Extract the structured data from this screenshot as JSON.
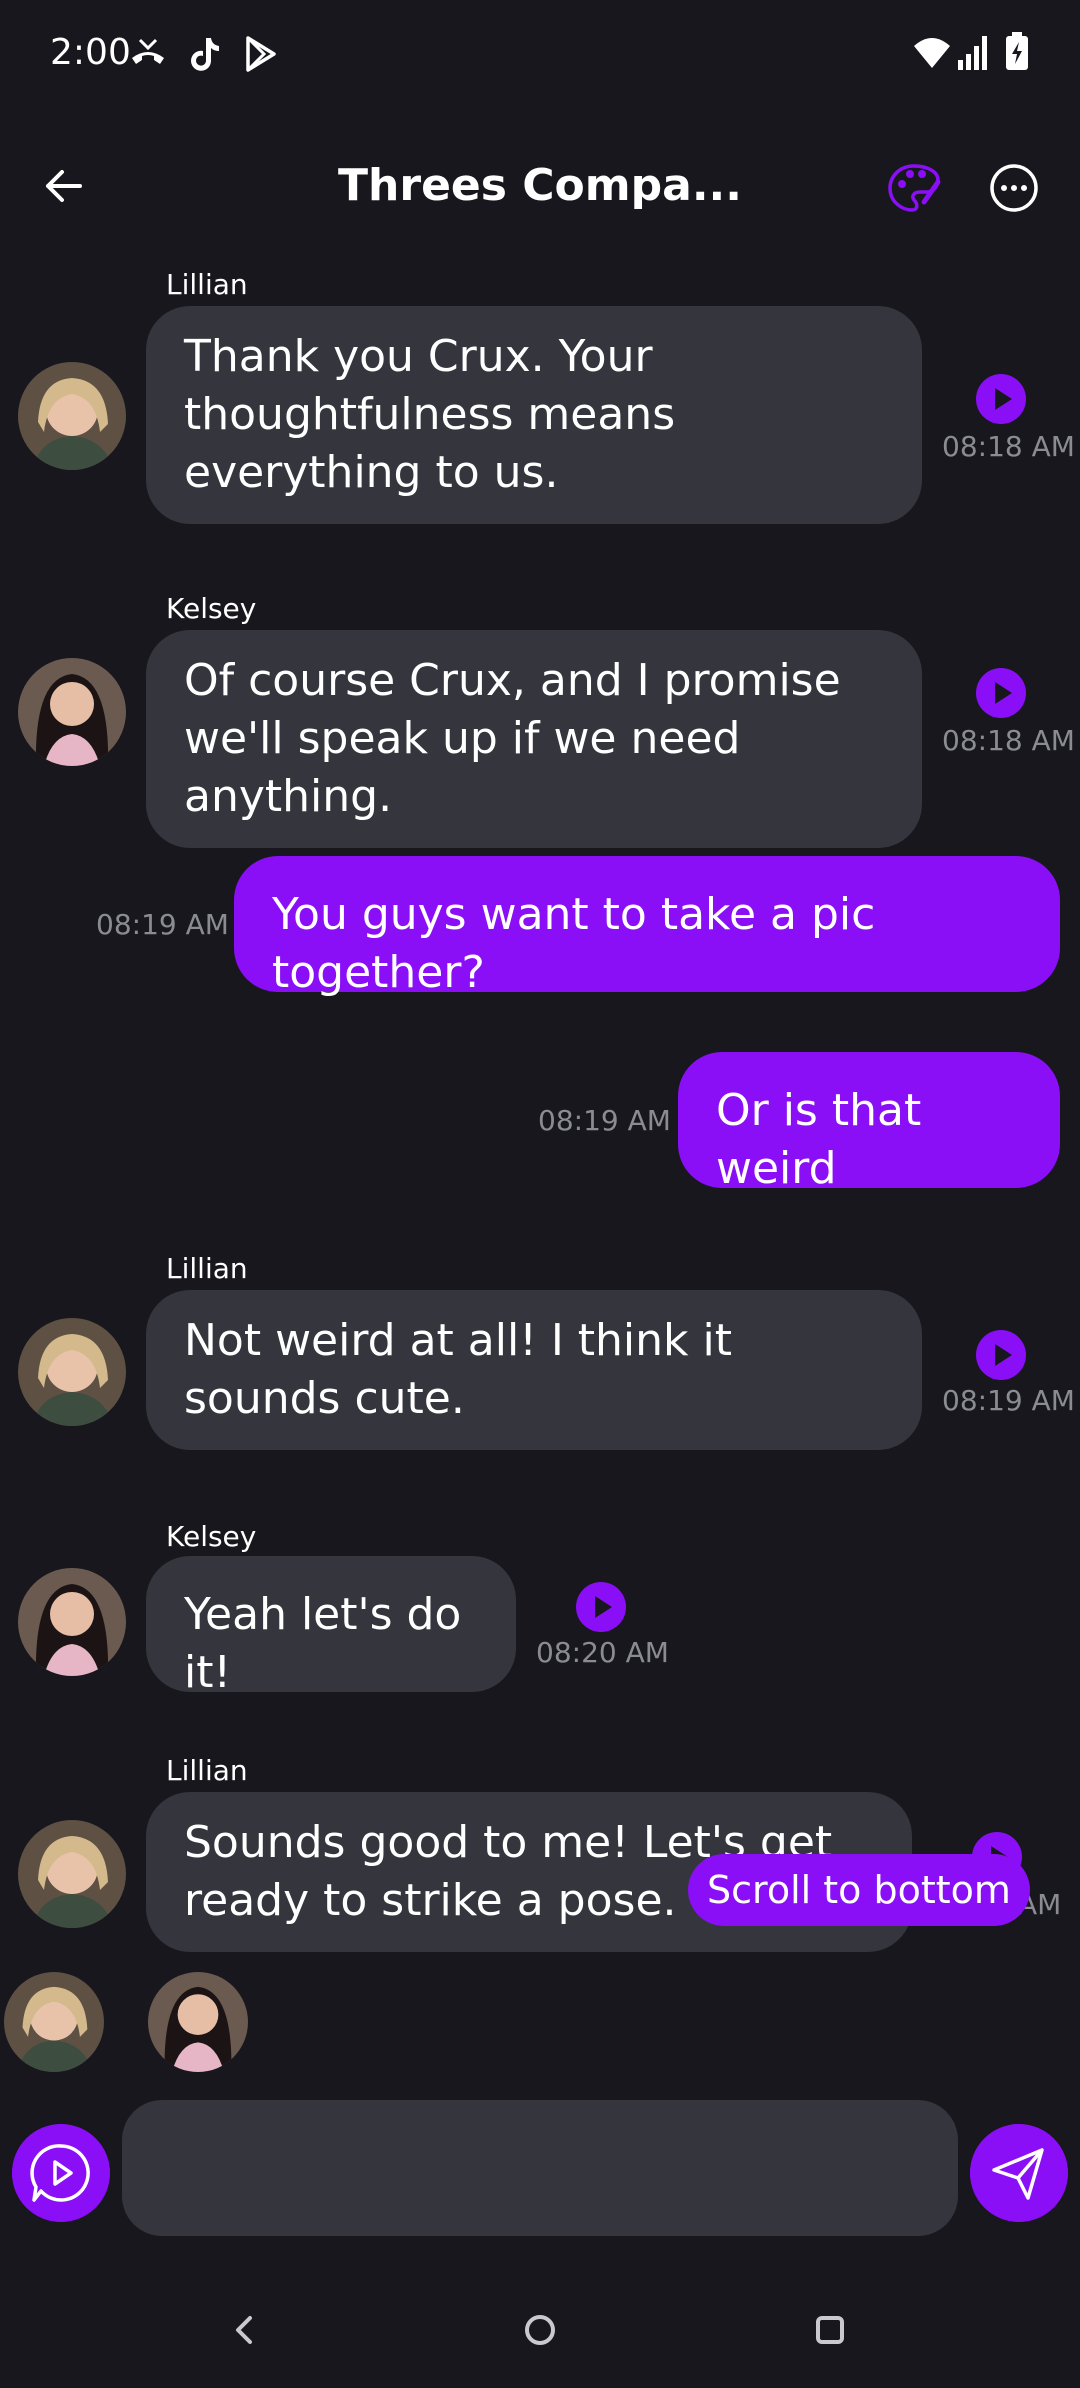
{
  "status_bar": {
    "time": "2:00",
    "icons": [
      "missed-call-icon",
      "tiktok-icon",
      "play-store-icon",
      "wifi-icon",
      "signal-icon",
      "battery-charging-icon"
    ]
  },
  "header": {
    "title": "Threes Compa...",
    "back_icon": "arrow-left-icon",
    "palette_icon": "palette-icon",
    "more_icon": "more-horizontal-icon"
  },
  "messages": [
    {
      "sender": "Lillian",
      "text": "Thank you Crux. Your thoughtfulness means everything to us.",
      "time": "08:18 AM",
      "outgoing": false
    },
    {
      "sender": "Kelsey",
      "text": "Of course Crux, and I promise we'll speak up if we need anything.",
      "time": "08:18 AM",
      "outgoing": false
    },
    {
      "text": "You guys want to take a pic together?",
      "time": "08:19 AM",
      "outgoing": true
    },
    {
      "text": "Or is that weird",
      "time": "08:19 AM",
      "outgoing": true
    },
    {
      "sender": "Lillian",
      "text": "Not weird at all! I think it sounds cute.",
      "time": "08:19 AM",
      "outgoing": false
    },
    {
      "sender": "Kelsey",
      "text": "Yeah let's do it!",
      "time": "08:20 AM",
      "outgoing": false
    },
    {
      "sender": "Lillian",
      "text": "Sounds good to me! Let's get ready to strike a pose.",
      "time": "AM",
      "outgoing": false
    }
  ],
  "scroll_to_bottom": "Scroll to bottom",
  "input": {
    "value": "",
    "placeholder": ""
  },
  "colors": {
    "accent": "#8a0ff7",
    "background": "#17171d",
    "bubble": "#35363d",
    "timestamp": "#8b8b93"
  }
}
